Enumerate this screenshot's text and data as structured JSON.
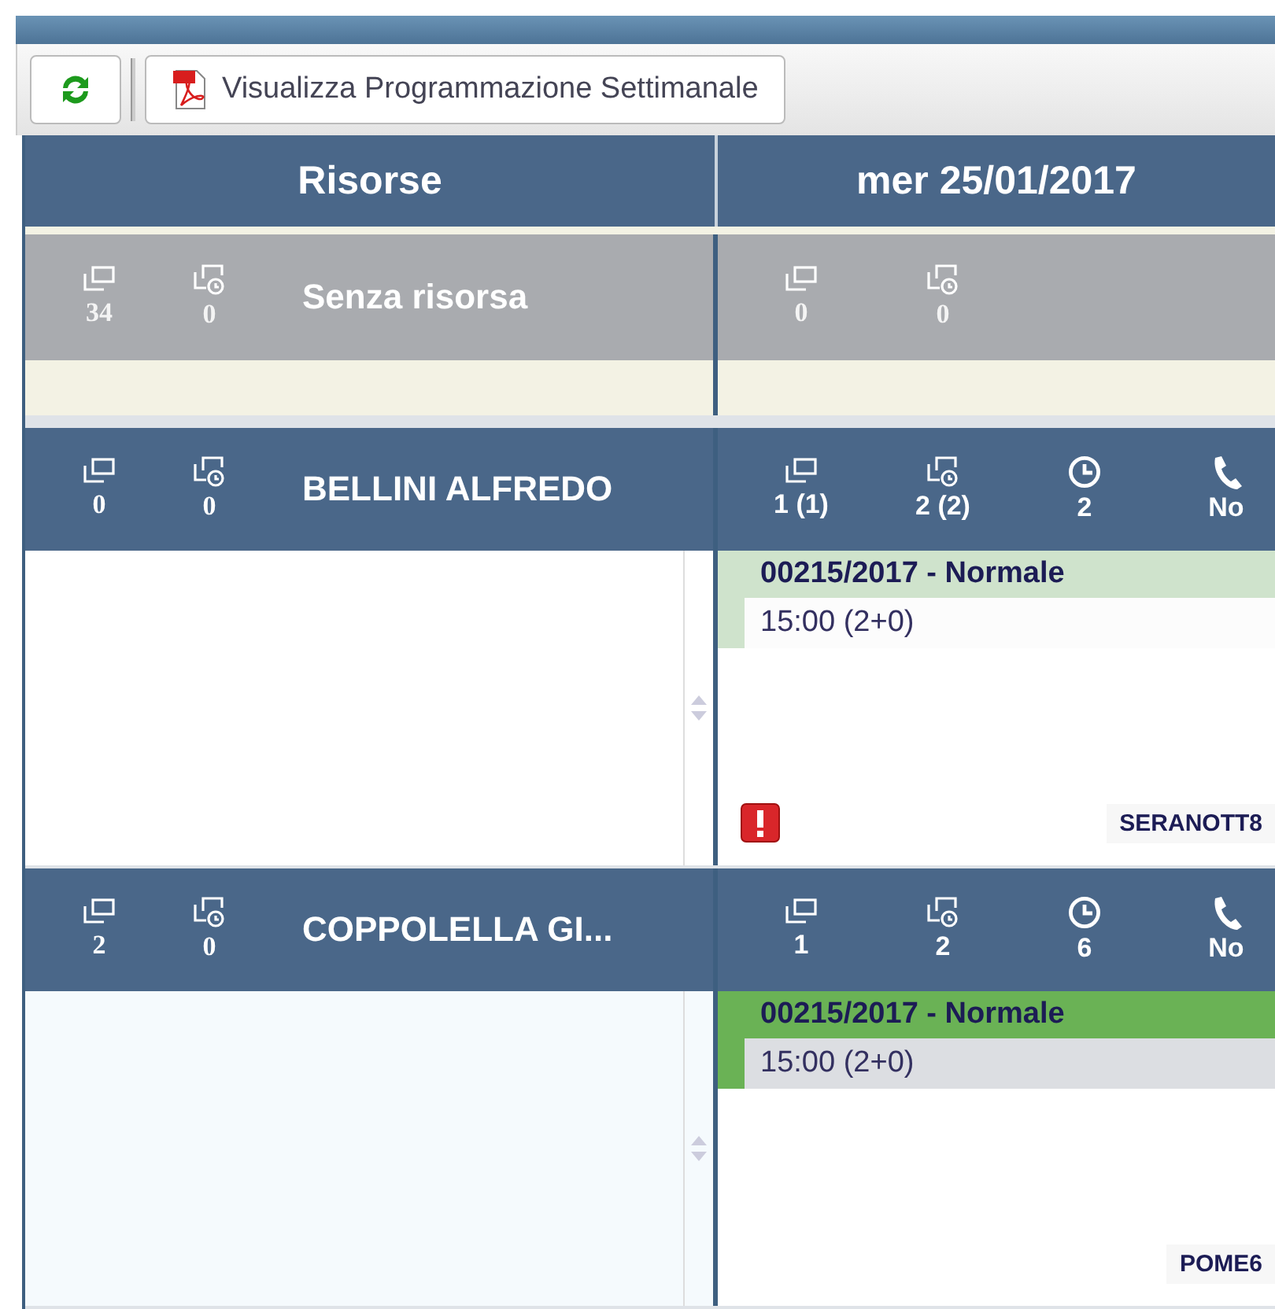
{
  "toolbar": {
    "buttons": [
      {
        "kind": "refresh"
      },
      {
        "kind": "pdf",
        "label": "Visualizza Programmazione Settimanale"
      }
    ]
  },
  "header": {
    "resources": "Risorse",
    "day": "mer 25/01/2017"
  },
  "rows": [
    {
      "kind": "unassigned",
      "name": "Senza risorsa",
      "resource_counts": [
        "34",
        "0"
      ],
      "day_stats": [
        "0",
        "0"
      ]
    },
    {
      "kind": "resource",
      "name": "BELLINI ALFREDO",
      "resource_counts": [
        "0",
        "0"
      ],
      "day_stats": [
        "1 (1)",
        "2 (2)",
        "2",
        "No"
      ],
      "card": {
        "title": "00215/2017 - Normale",
        "time": "15:00 (2+0)",
        "code": "SERANOTT8",
        "alert": true,
        "color": "#cfe3cc"
      }
    },
    {
      "kind": "resource",
      "name": "COPPOLELLA GI...",
      "resource_counts": [
        "2",
        "0"
      ],
      "day_stats": [
        "1",
        "2",
        "6",
        "No"
      ],
      "card": {
        "title": "00215/2017 - Normale",
        "time": "15:00 (2+0)",
        "code": "POME6",
        "alert": false,
        "color": "#6ab255"
      }
    }
  ]
}
